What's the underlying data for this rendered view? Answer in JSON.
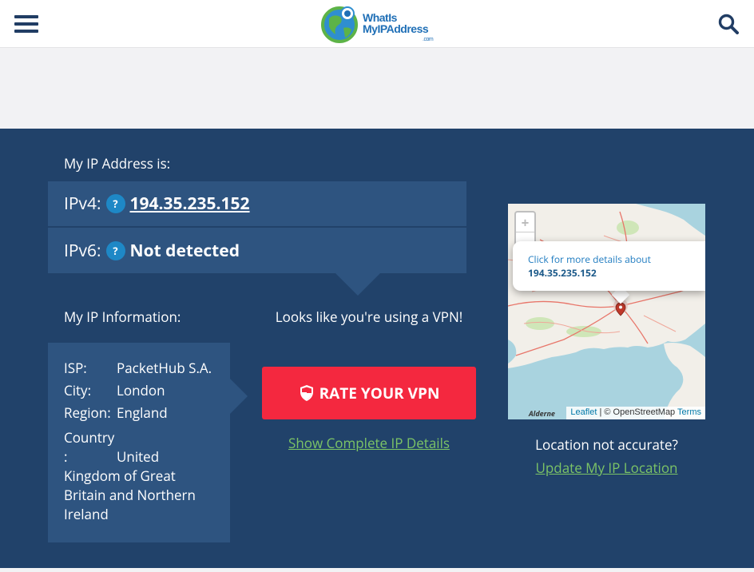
{
  "header": {
    "menu_icon": "hamburger-menu-icon",
    "logo_line1": "WhatIs",
    "logo_line2": "MyIPAddress",
    "logo_suffix": ".com",
    "search_icon": "magnifier-search-icon"
  },
  "ip": {
    "heading": "My IP Address is:",
    "ipv4_label": "IPv4:",
    "ipv4_value": "194.35.235.152",
    "ipv6_label": "IPv6:",
    "ipv6_value": "Not detected",
    "help_glyph": "?"
  },
  "info": {
    "heading": "My IP Information:",
    "isp_label": "ISP:",
    "isp_value": "PacketHub S.A.",
    "city_label": "City:",
    "city_value": "London",
    "region_label": "Region:",
    "region_value": "England",
    "country_label_1": "Country",
    "country_label_2": ":",
    "country_value_1": "United",
    "country_value_rest": "Kingdom of Great Britain and Northern Ireland"
  },
  "vpn": {
    "message": "Looks like you're using a VPN!",
    "rate_button": "RATE YOUR VPN",
    "rate_icon": "shield-icon",
    "details_link": "Show Complete IP Details"
  },
  "map": {
    "zoom_in": "+",
    "zoom_out": "−",
    "popup_line1": "Click for more details about",
    "popup_ip": "194.35.235.152",
    "place_label": "Alderne",
    "attrib_leaflet": "Leaflet",
    "attrib_sep": " | © OpenStreetMap ",
    "attrib_terms": "Terms",
    "marker_icon": "map-pin-icon"
  },
  "location": {
    "question": "Location not accurate?",
    "update_link": "Update My IP Location"
  },
  "colors": {
    "hero_bg": "#21426a",
    "panel_bg": "#2e5480",
    "accent_red": "#f4283f",
    "link_green": "#7cc466",
    "help_blue": "#1e88c6"
  }
}
